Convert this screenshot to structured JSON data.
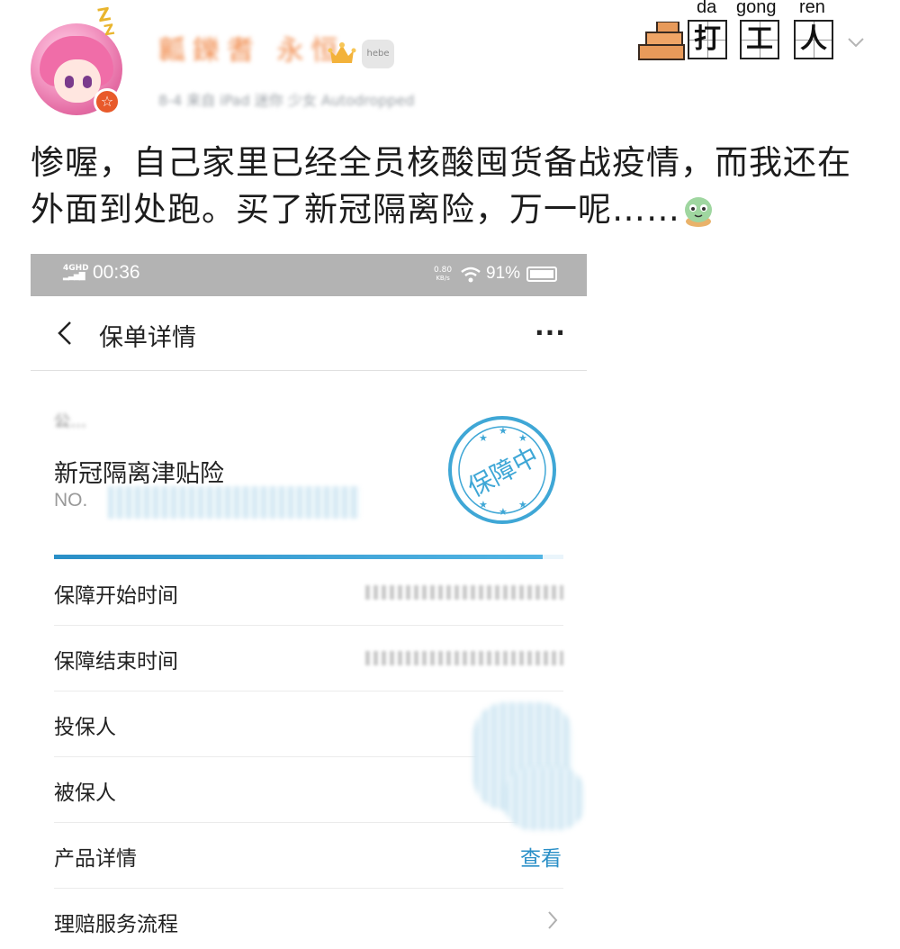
{
  "post": {
    "username": "瓤鑠耆 永恒",
    "meta": "8-4  来自 iPad 迷你 少女 Autodropped",
    "text": "惨喔，自己家里已经全员核酸囤货备战疫情，而我还在外面到处跑。买了新冠隔离险，万一呢……",
    "zz": "Z\nZ",
    "vip_badge": "hebe",
    "sticker": {
      "pinyin": [
        "da",
        "gong",
        "ren"
      ],
      "chars": [
        "打",
        "工",
        "人"
      ]
    }
  },
  "phone": {
    "status_bar": {
      "network": "4GHD",
      "time": "00:36",
      "speed_value": "0.80",
      "speed_unit": "KB/s",
      "battery": "91%"
    },
    "nav": {
      "title": "保单详情",
      "more": "···"
    },
    "policy": {
      "holder_masked": "公…",
      "product_name": "新冠隔离津贴险",
      "policy_no_prefix": "NO.",
      "stamp_text": "保障中",
      "progress_fraction": 0.96
    },
    "rows": [
      {
        "label": "保障开始时间"
      },
      {
        "label": "保障结束时间"
      },
      {
        "label": "投保人"
      },
      {
        "label": "被保人"
      },
      {
        "label": "产品详情",
        "action": "查看"
      },
      {
        "label": "理赔服务流程"
      }
    ]
  },
  "colors": {
    "accent_blue": "#2a8fc7",
    "status_bar_bg": "#b3b3b3",
    "stamp": "#3fa7d6"
  }
}
